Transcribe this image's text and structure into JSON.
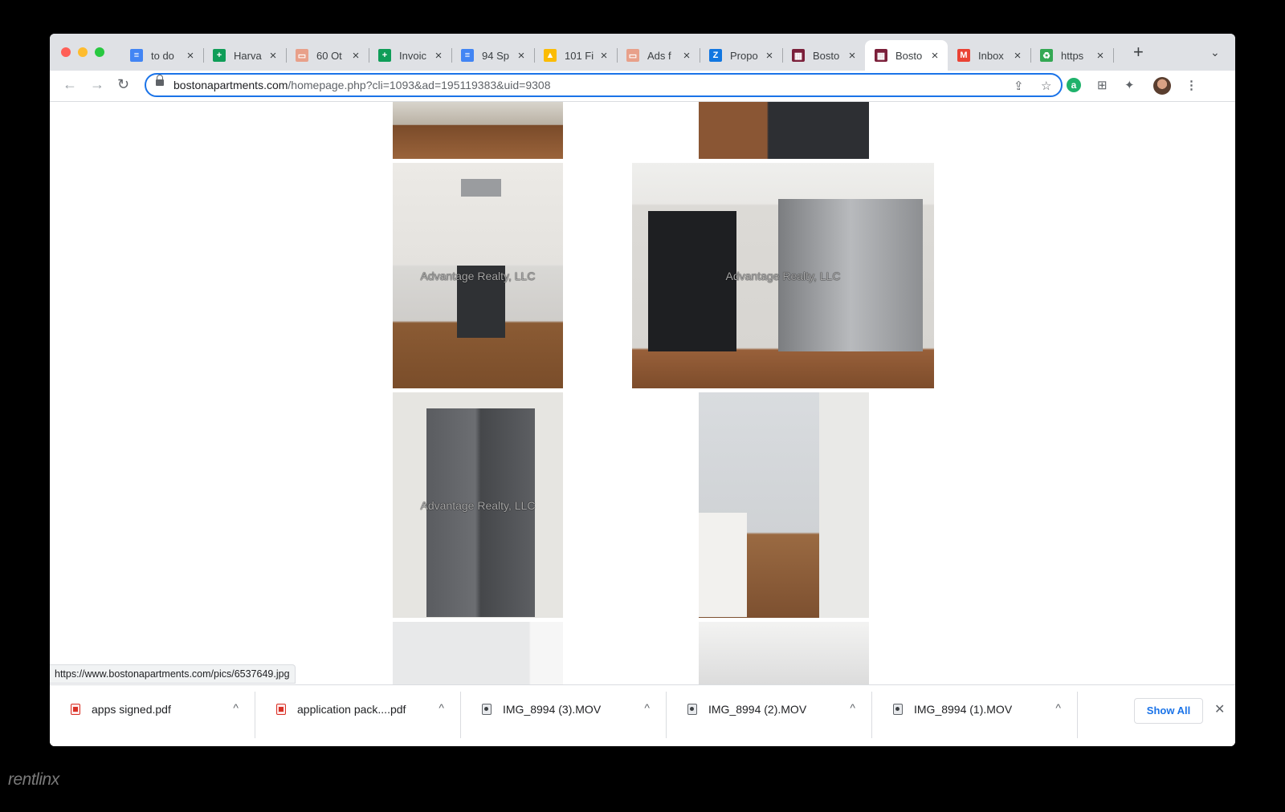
{
  "browser": {
    "tabs": [
      {
        "title": "to do",
        "icon": "google-docs-icon",
        "color": "#4285f4",
        "glyph": "≡"
      },
      {
        "title": "Harva",
        "icon": "google-sheets-icon",
        "color": "#0f9d58",
        "glyph": "+"
      },
      {
        "title": "60 Ot",
        "icon": "inbox-tray-icon",
        "color": "#e8a08a",
        "glyph": "▭"
      },
      {
        "title": "Invoic",
        "icon": "google-sheets-icon",
        "color": "#0f9d58",
        "glyph": "+"
      },
      {
        "title": "94 Sp",
        "icon": "google-docs-icon",
        "color": "#4285f4",
        "glyph": "≡"
      },
      {
        "title": "101 Fi",
        "icon": "google-drive-icon",
        "color": "#fbbc04",
        "glyph": "▲"
      },
      {
        "title": "Ads f",
        "icon": "inbox-tray-icon",
        "color": "#e8a08a",
        "glyph": "▭"
      },
      {
        "title": "Propo",
        "icon": "zillow-icon",
        "color": "#1277e1",
        "glyph": "Z"
      },
      {
        "title": "Bosto",
        "icon": "building-icon",
        "color": "#7b1f3a",
        "glyph": "▦"
      },
      {
        "title": "Bosto",
        "icon": "building-icon",
        "color": "#7b1f3a",
        "glyph": "▦",
        "active": true
      },
      {
        "title": "Inbox",
        "icon": "gmail-icon",
        "color": "#ea4335",
        "glyph": "M"
      },
      {
        "title": "https",
        "icon": "recycle-icon",
        "color": "#34a853",
        "glyph": "♻"
      }
    ],
    "url_host": "bostonapartments.com",
    "url_path": "/homepage.php?cli=1093&ad=195119383&uid=9308"
  },
  "photos": {
    "watermark": "Advantage Realty, LLC"
  },
  "status_url": "https://www.bostonapartments.com/pics/6537649.jpg",
  "downloads": {
    "items": [
      {
        "name": "apps signed.pdf",
        "type": "pdf"
      },
      {
        "name": "application pack....pdf",
        "type": "pdf"
      },
      {
        "name": "IMG_8994 (3).MOV",
        "type": "mov"
      },
      {
        "name": "IMG_8994 (2).MOV",
        "type": "mov"
      },
      {
        "name": "IMG_8994 (1).MOV",
        "type": "mov"
      }
    ],
    "show_all": "Show All"
  },
  "brand": "rentlinx"
}
